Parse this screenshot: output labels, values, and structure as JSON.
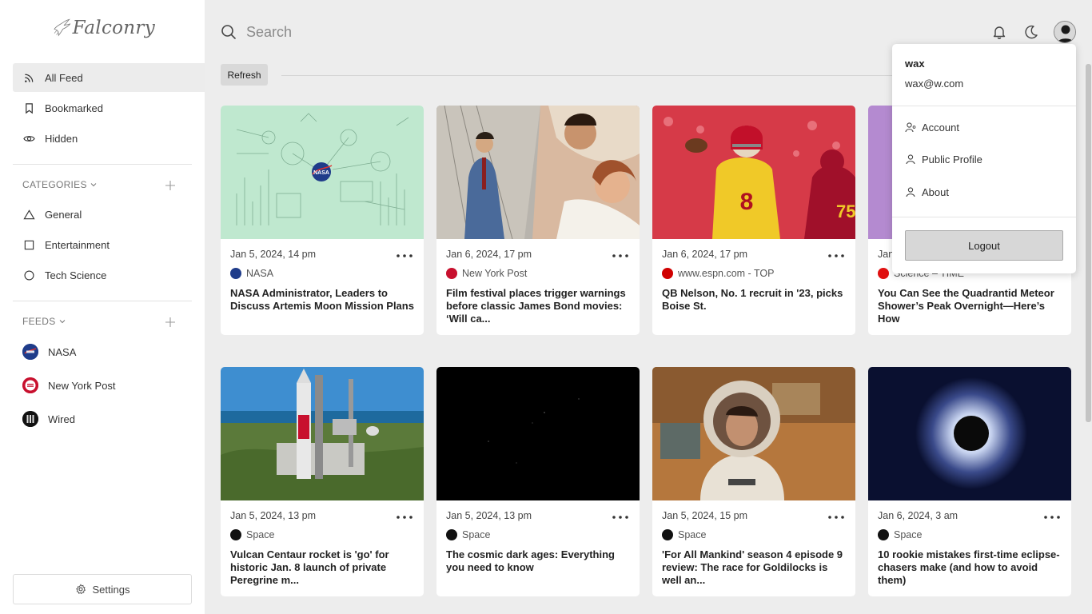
{
  "app": {
    "name": "Falconry"
  },
  "sidebar": {
    "nav": [
      {
        "label": "All Feed",
        "icon": "rss-icon",
        "active": true
      },
      {
        "label": "Bookmarked",
        "icon": "bookmark-icon"
      },
      {
        "label": "Hidden",
        "icon": "eye-icon"
      }
    ],
    "categories_title": "CATEGORIES",
    "categories": [
      {
        "label": "General",
        "icon": "triangle-icon"
      },
      {
        "label": "Entertainment",
        "icon": "square-icon"
      },
      {
        "label": "Tech Science",
        "icon": "circle-icon"
      }
    ],
    "feeds_title": "FEEDS",
    "feeds": [
      {
        "label": "NASA",
        "color": "#1f3c8a"
      },
      {
        "label": "New York Post",
        "color": "#c8102e"
      },
      {
        "label": "Wired",
        "color": "#111111"
      }
    ],
    "settings_label": "Settings"
  },
  "search": {
    "placeholder": "Search"
  },
  "refresh_label": "Refresh",
  "cards": [
    {
      "date": "Jan 5, 2024, 14 pm",
      "source": "NASA",
      "source_color": "#1f3c8a",
      "title": "NASA Administrator, Leaders to Discuss Artemis Moon Mission Plans"
    },
    {
      "date": "Jan 6, 2024, 17 pm",
      "source": "New York Post",
      "source_color": "#c8102e",
      "title": "Film festival places trigger warnings before classic James Bond movies: ‘Will ca..."
    },
    {
      "date": "Jan 6, 2024, 17 pm",
      "source": "www.espn.com - TOP",
      "source_color": "#d00000",
      "title": "QB Nelson, No. 1 recruit in '23, picks Boise St."
    },
    {
      "date": "Jan",
      "source": "Science – TIME",
      "source_color": "#e01010",
      "title": "You Can See the Quadrantid Meteor Shower’s Peak Overnight—Here’s How"
    },
    {
      "date": "Jan 5, 2024, 13 pm",
      "source": "Space",
      "source_color": "#111111",
      "title": "Vulcan Centaur rocket is 'go' for historic Jan. 8 launch of private Peregrine m..."
    },
    {
      "date": "Jan 5, 2024, 13 pm",
      "source": "Space",
      "source_color": "#111111",
      "title": "The cosmic dark ages: Everything you need to know"
    },
    {
      "date": "Jan 5, 2024, 15 pm",
      "source": "Space",
      "source_color": "#111111",
      "title": "'For All Mankind' season 4 episode 9 review: The race for Goldilocks is well an..."
    },
    {
      "date": "Jan 6, 2024, 3 am",
      "source": "Space",
      "source_color": "#111111",
      "title": "10 rookie mistakes first-time eclipse-chasers make (and how to avoid them)"
    }
  ],
  "user_menu": {
    "name": "wax",
    "email": "wax@w.com",
    "items": [
      {
        "label": "Account",
        "icon": "user-gear-icon"
      },
      {
        "label": "Public Profile",
        "icon": "user-icon"
      },
      {
        "label": "About",
        "icon": "user-icon"
      }
    ],
    "logout_label": "Logout"
  }
}
